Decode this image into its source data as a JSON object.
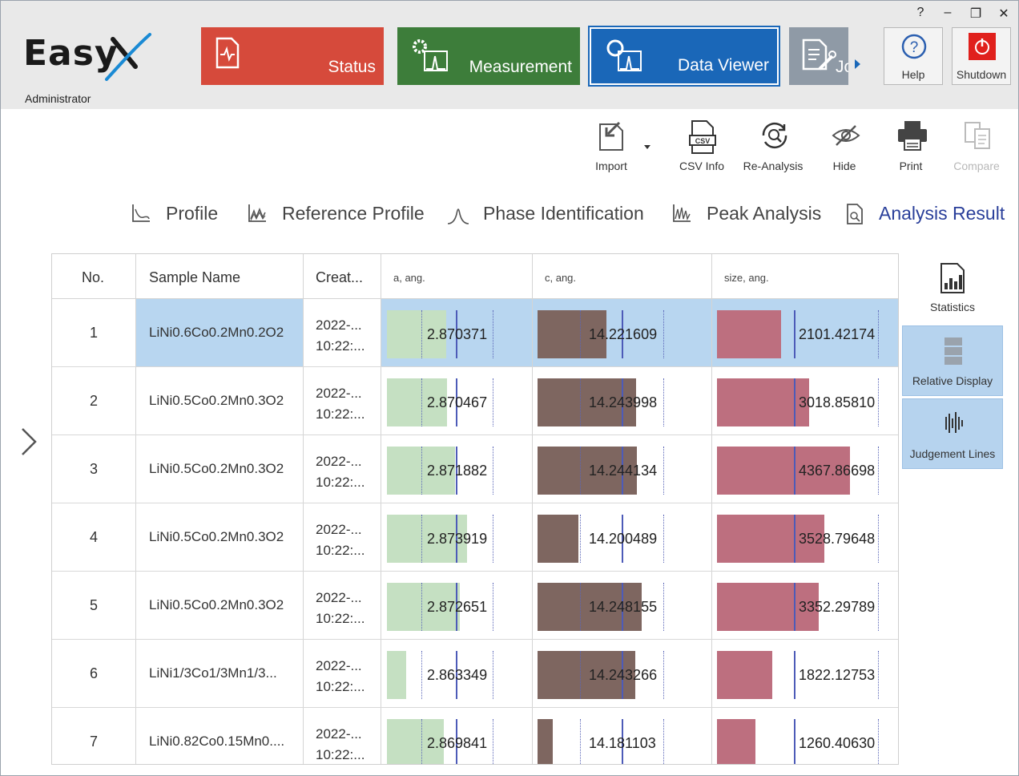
{
  "window_controls": [
    "?",
    "–",
    "❐",
    "✕"
  ],
  "app": {
    "logo_text": "Easy",
    "user_role": "Administrator"
  },
  "nav_tiles": [
    {
      "label": "Status",
      "icon": "document-pulse-icon",
      "color": "#d64a3b"
    },
    {
      "label": "Measurement",
      "icon": "gear-spectrum-icon",
      "color": "#3d7d3a"
    },
    {
      "label": "Data Viewer",
      "icon": "search-spectrum-icon",
      "color": "#1a67b8"
    },
    {
      "label": "Jo",
      "icon": "document-wrench-icon",
      "color": "#8f9aa6"
    }
  ],
  "system_buttons": [
    {
      "label": "Help",
      "icon": "question-circle-icon"
    },
    {
      "label": "Shutdown",
      "icon": "power-icon"
    }
  ],
  "toolbar": [
    {
      "label": "Import",
      "icon": "import-icon",
      "enabled": true
    },
    {
      "label": "CSV Info",
      "icon": "csv-file-icon",
      "enabled": true
    },
    {
      "label": "Re-Analysis",
      "icon": "reanalysis-icon",
      "enabled": true
    },
    {
      "label": "Hide",
      "icon": "eye-slash-icon",
      "enabled": true
    },
    {
      "label": "Print",
      "icon": "printer-icon",
      "enabled": true
    },
    {
      "label": "Compare",
      "icon": "compare-icon",
      "enabled": false
    }
  ],
  "tabs": [
    {
      "label": "Profile",
      "active": false
    },
    {
      "label": "Reference Profile",
      "active": false
    },
    {
      "label": "Phase Identification",
      "active": false
    },
    {
      "label": "Peak Analysis",
      "active": false
    },
    {
      "label": "Analysis Result",
      "active": true
    }
  ],
  "table": {
    "columns": [
      "No.",
      "Sample Name",
      "Creat...",
      "a, ang.",
      "c, ang.",
      "size, ang."
    ],
    "rows": [
      {
        "no": "1",
        "name": "LiNi0.6Co0.2Mn0.2O2",
        "date1": "2022-...",
        "date2": "10:22:...",
        "a": "2.870371",
        "c": "14.221609",
        "size": "2101.42174",
        "a_num": 2.870371,
        "c_num": 14.221609,
        "size_num": 2101.42174,
        "selected": true
      },
      {
        "no": "2",
        "name": "LiNi0.5Co0.2Mn0.3O2",
        "date1": "2022-...",
        "date2": "10:22:...",
        "a": "2.870467",
        "c": "14.243998",
        "size": "3018.85810",
        "a_num": 2.870467,
        "c_num": 14.243998,
        "size_num": 3018.8581,
        "selected": false
      },
      {
        "no": "3",
        "name": "LiNi0.5Co0.2Mn0.3O2",
        "date1": "2022-...",
        "date2": "10:22:...",
        "a": "2.871882",
        "c": "14.244134",
        "size": "4367.86698",
        "a_num": 2.871882,
        "c_num": 14.244134,
        "size_num": 4367.86698,
        "selected": false
      },
      {
        "no": "4",
        "name": "LiNi0.5Co0.2Mn0.3O2",
        "date1": "2022-...",
        "date2": "10:22:...",
        "a": "2.873919",
        "c": "14.200489",
        "size": "3528.79648",
        "a_num": 2.873919,
        "c_num": 14.200489,
        "size_num": 3528.79648,
        "selected": false
      },
      {
        "no": "5",
        "name": "LiNi0.5Co0.2Mn0.3O2",
        "date1": "2022-...",
        "date2": "10:22:...",
        "a": "2.872651",
        "c": "14.248155",
        "size": "3352.29789",
        "a_num": 2.872651,
        "c_num": 14.248155,
        "size_num": 3352.29789,
        "selected": false
      },
      {
        "no": "6",
        "name": "LiNi1/3Co1/3Mn1/3...",
        "date1": "2022-...",
        "date2": "10:22:...",
        "a": "2.863349",
        "c": "14.243266",
        "size": "1822.12753",
        "a_num": 2.863349,
        "c_num": 14.243266,
        "size_num": 1822.12753,
        "selected": false
      },
      {
        "no": "7",
        "name": "LiNi0.82Co0.15Mn0....",
        "date1": "2022-...",
        "date2": "10:22:...",
        "a": "2.869841",
        "c": "14.181103",
        "size": "1260.40630",
        "a_num": 2.869841,
        "c_num": 14.181103,
        "size_num": 1260.4063,
        "selected": false
      }
    ]
  },
  "right_panel": [
    {
      "label": "Statistics",
      "icon": "statistics-icon",
      "highlighted": false
    },
    {
      "label": "Relative Display",
      "icon": "stacked-bars-icon",
      "highlighted": true
    },
    {
      "label": "Judgement Lines",
      "icon": "judgement-lines-icon",
      "highlighted": true
    }
  ],
  "colors": {
    "a_bar": "#c5e0c2",
    "c_bar": "#7e6660",
    "size_bar": "#bd6f7f",
    "selection": "#b8d6f0",
    "active_tab": "#2a3f9a"
  }
}
